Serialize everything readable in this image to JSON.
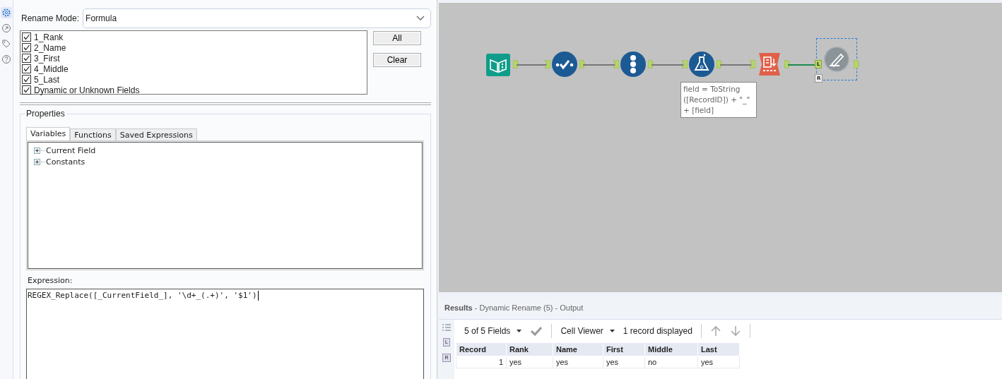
{
  "rail": [
    {
      "kind": "gear",
      "selected": true
    },
    {
      "kind": "arrow",
      "selected": false
    },
    {
      "kind": "tag",
      "selected": false
    },
    {
      "kind": "help",
      "selected": false
    }
  ],
  "config": {
    "mode_label": "Rename Mode:",
    "mode_value": "Formula",
    "fields": [
      {
        "label": "1_Rank",
        "checked": true
      },
      {
        "label": "2_Name",
        "checked": true
      },
      {
        "label": "3_First",
        "checked": true
      },
      {
        "label": "4_Middle",
        "checked": true
      },
      {
        "label": "5_Last",
        "checked": true
      },
      {
        "label": "Dynamic or Unknown Fields",
        "checked": true
      }
    ],
    "buttons": [
      "All",
      "Clear"
    ],
    "properties_title": "Properties",
    "tabs": [
      {
        "label": "Variables",
        "selected": true
      },
      {
        "label": "Functions",
        "selected": false
      },
      {
        "label": "Saved Expressions",
        "selected": false
      }
    ],
    "tree": [
      {
        "label": "Current Field",
        "expanded": false
      },
      {
        "label": "Constants",
        "expanded": false
      }
    ],
    "expression_label": "Expression:",
    "expression": "REGEX_Replace([_CurrentField_], '\\d+_(.+)', '$1')"
  },
  "canvas": {
    "nodes": [
      {
        "kind": "input",
        "selected": false
      },
      {
        "kind": "select",
        "selected": false
      },
      {
        "kind": "recordid",
        "selected": false
      },
      {
        "kind": "formula",
        "selected": false
      },
      {
        "kind": "transpose",
        "selected": false
      },
      {
        "kind": "rename",
        "selected": true
      }
    ],
    "annotation": "field = ToString\n([RecordID]) + \"_\"\n+ [field]",
    "anchors": [
      "L",
      "R"
    ]
  },
  "results": {
    "title": "Results",
    "subtitle": " - Dynamic Rename (5) - Output",
    "toolbar": {
      "fields": "5 of 5 Fields",
      "viewer": "Cell Viewer",
      "count": "1 record displayed"
    },
    "side_anchors": [
      "L",
      "R"
    ],
    "columns": [
      "Record",
      "Rank",
      "Name",
      "First",
      "Middle",
      "Last"
    ],
    "rows": [
      [
        "1",
        "yes",
        "yes",
        "yes",
        "no",
        "yes"
      ]
    ]
  }
}
